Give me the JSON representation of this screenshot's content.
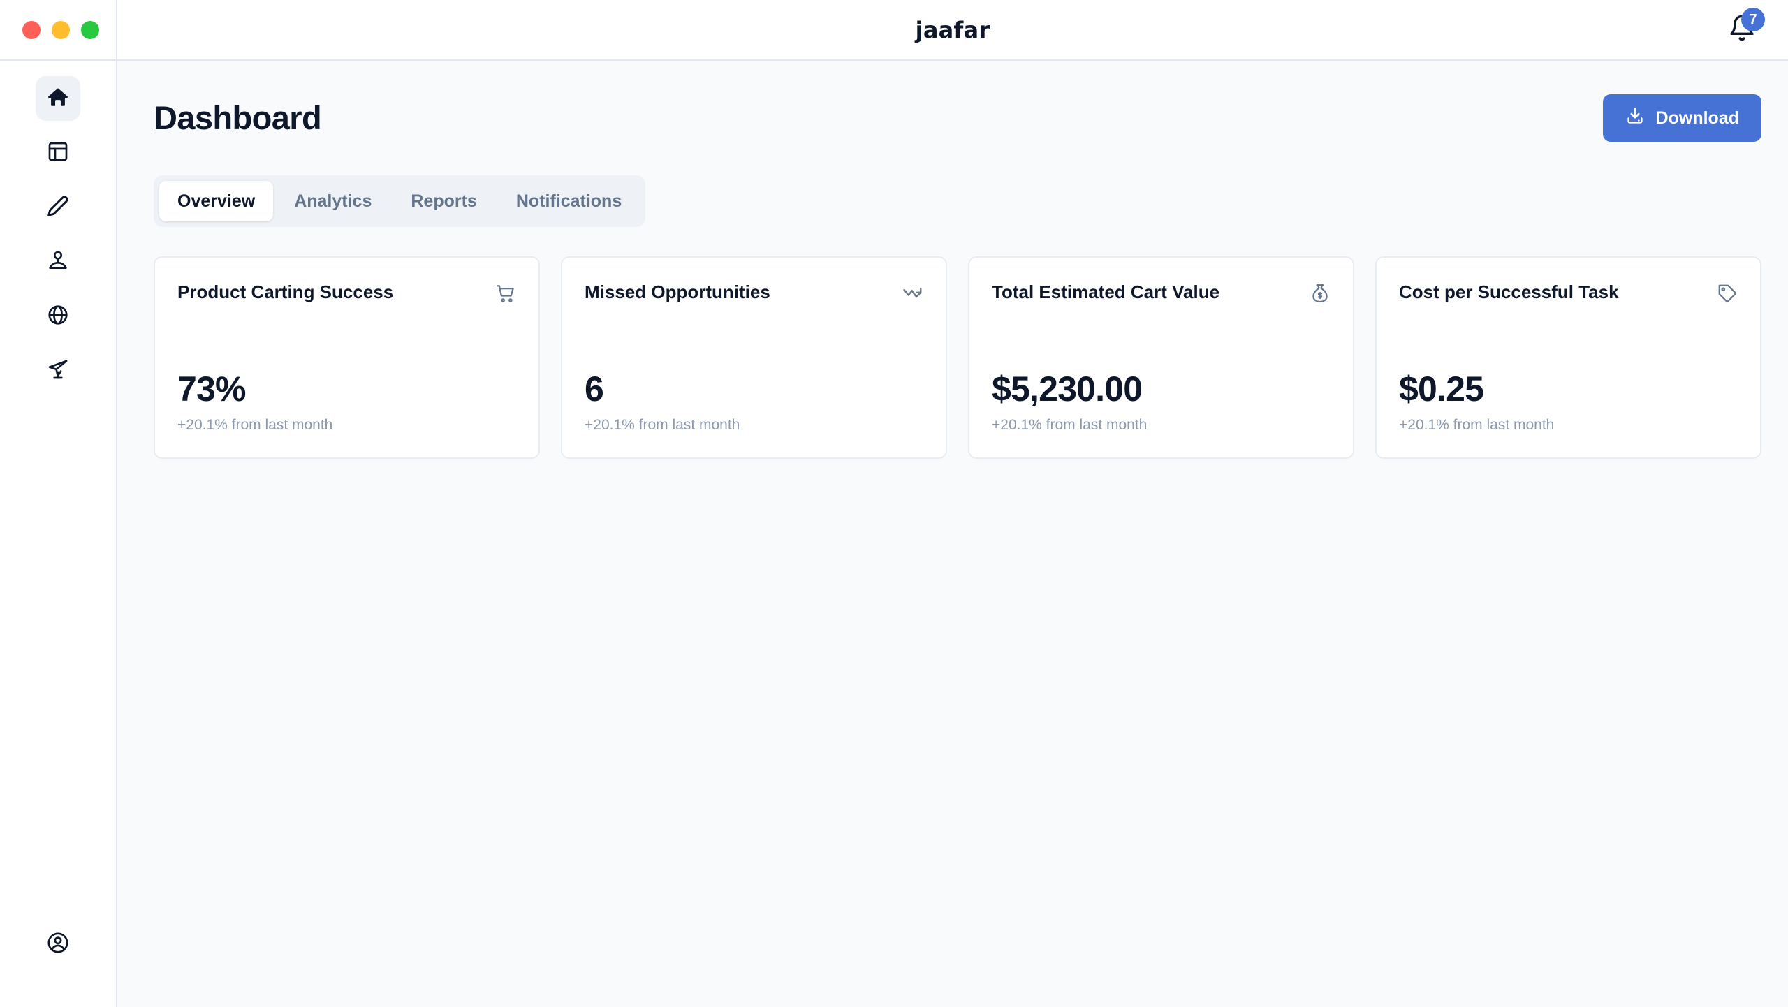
{
  "window": {
    "traffic_lights": [
      {
        "name": "close",
        "color": "#ff5f57"
      },
      {
        "name": "minimize",
        "color": "#ffbd2e"
      },
      {
        "name": "maximize",
        "color": "#28c840"
      }
    ]
  },
  "header": {
    "brand": "jaafar",
    "notifications": {
      "icon": "bell-icon",
      "count": "7",
      "badge_color": "#4572d4"
    }
  },
  "sidebar": {
    "items": [
      {
        "icon": "home-icon",
        "name": "home",
        "active": true
      },
      {
        "icon": "layout-panel-icon",
        "name": "layout",
        "active": false
      },
      {
        "icon": "pencil-icon",
        "name": "edit",
        "active": false
      },
      {
        "icon": "user-profile-icon",
        "name": "profile",
        "active": false
      },
      {
        "icon": "globe-icon",
        "name": "globe",
        "active": false
      },
      {
        "icon": "paper-plane-icon",
        "name": "send",
        "active": false
      }
    ],
    "bottom_item": {
      "icon": "account-circle-icon",
      "name": "account"
    }
  },
  "page": {
    "title": "Dashboard",
    "download_button": {
      "label": "Download",
      "icon": "download-icon",
      "color": "#4572d4"
    }
  },
  "tabs": {
    "active": "Overview",
    "items": [
      {
        "label": "Overview",
        "active": true
      },
      {
        "label": "Analytics",
        "active": false
      },
      {
        "label": "Reports",
        "active": false
      },
      {
        "label": "Notifications",
        "active": false
      }
    ]
  },
  "cards": [
    {
      "title": "Product Carting Success",
      "icon": "shopping-cart-icon",
      "value": "73%",
      "sub": "+20.1% from last month"
    },
    {
      "title": "Missed Opportunities",
      "icon": "trending-down-icon",
      "value": "6",
      "sub": "+20.1% from last month"
    },
    {
      "title": "Total Estimated Cart Value",
      "icon": "money-bag-icon",
      "value": "$5,230.00",
      "sub": "+20.1% from last month"
    },
    {
      "title": "Cost per Successful Task",
      "icon": "tag-icon",
      "value": "$0.25",
      "sub": "+20.1% from last month"
    }
  ],
  "colors": {
    "accent": "#4572d4",
    "page_bg": "#f8fafc",
    "card_bg": "#ffffff",
    "border": "#e2e8f0",
    "text_primary": "#0f172a",
    "text_muted": "#64748b",
    "text_sub": "#8b98ab"
  }
}
